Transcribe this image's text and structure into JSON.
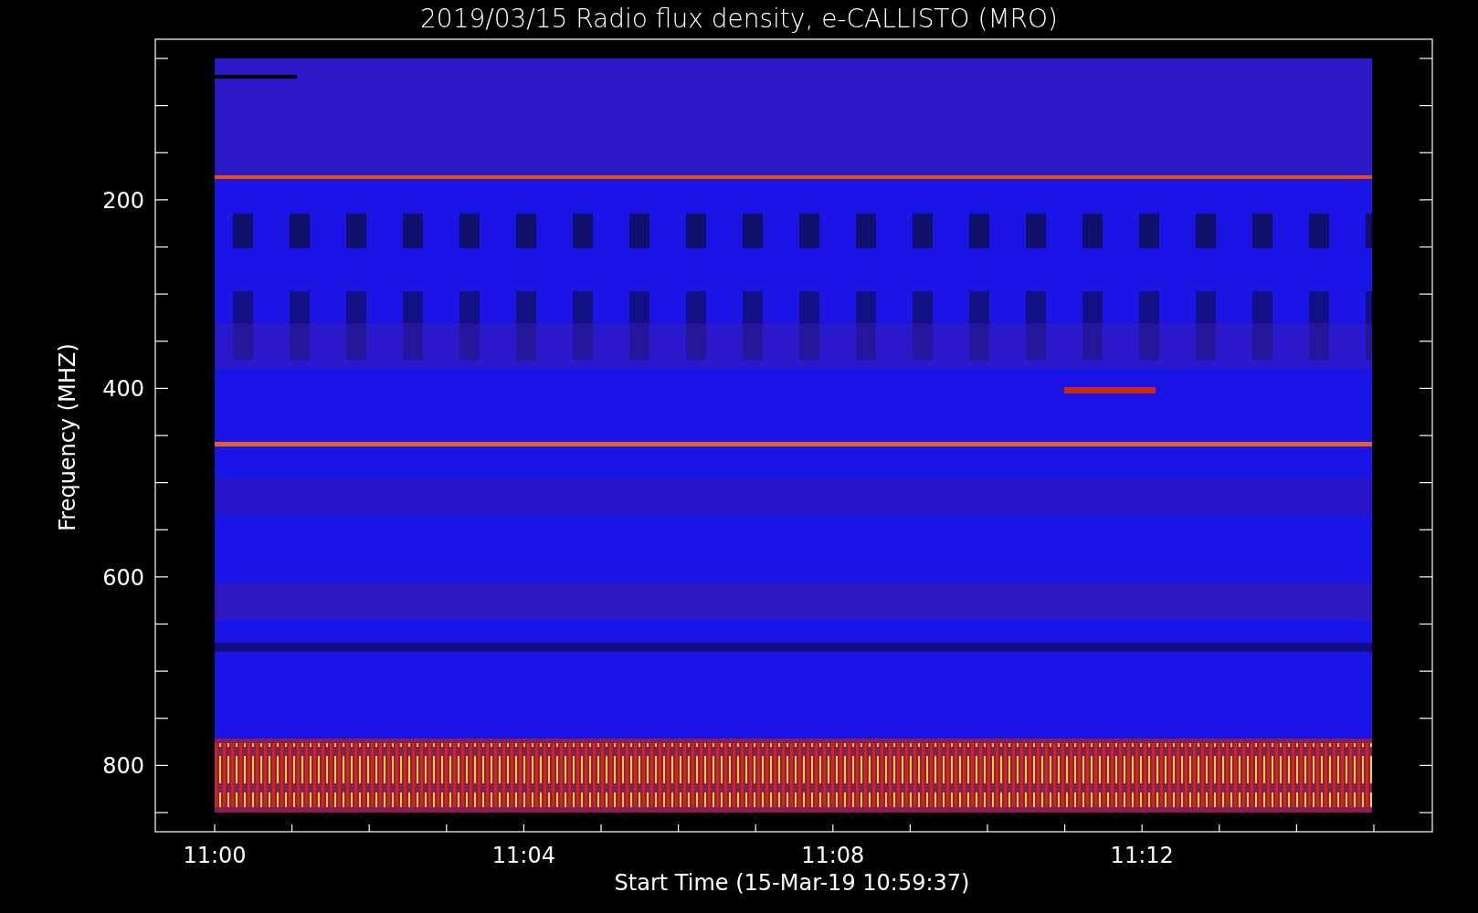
{
  "title": "2019/03/15  Radio flux density, e-CALLISTO (MRO)",
  "y_axis": {
    "label": "Frequency (MHZ)",
    "ticks": [
      "200",
      "400",
      "600",
      "800"
    ]
  },
  "x_axis": {
    "label": "Start Time (15-Mar-19 10:59:37)",
    "ticks": [
      "11:00",
      "11:04",
      "11:08",
      "11:12"
    ]
  }
}
